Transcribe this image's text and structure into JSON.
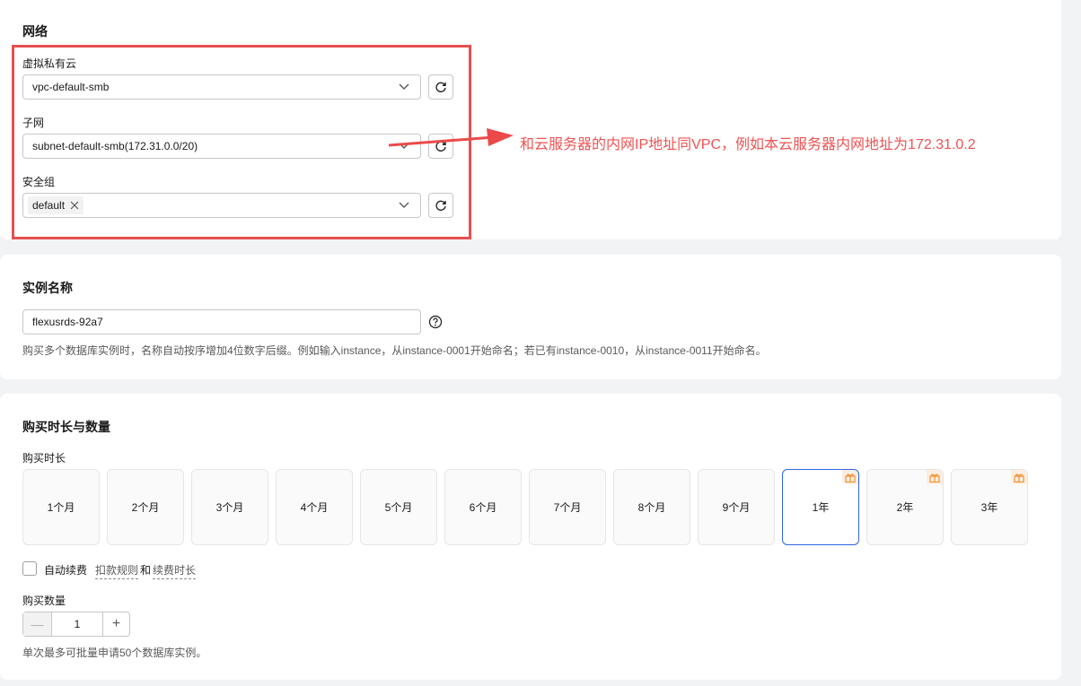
{
  "network": {
    "title": "网络",
    "vpc": {
      "label": "虚拟私有云",
      "value": "vpc-default-smb"
    },
    "subnet": {
      "label": "子网",
      "value": "subnet-default-smb(172.31.0.0/20)"
    },
    "security_group": {
      "label": "安全组",
      "tag": "default"
    }
  },
  "annotation": {
    "text": "和云服务器的内网IP地址同VPC，例如本云服务器内网地址为172.31.0.2",
    "color": "#f05252"
  },
  "instance_name": {
    "title": "实例名称",
    "value": "flexusrds-92a7",
    "hint": "购买多个数据库实例时，名称自动按序增加4位数字后缀。例如输入instance，从instance-0001开始命名；若已有instance-0010，从instance-0011开始命名。"
  },
  "purchase": {
    "title": "购买时长与数量",
    "duration_label": "购买时长",
    "durations": [
      {
        "label": "1个月",
        "gift": false,
        "selected": false
      },
      {
        "label": "2个月",
        "gift": false,
        "selected": false
      },
      {
        "label": "3个月",
        "gift": false,
        "selected": false
      },
      {
        "label": "4个月",
        "gift": false,
        "selected": false
      },
      {
        "label": "5个月",
        "gift": false,
        "selected": false
      },
      {
        "label": "6个月",
        "gift": false,
        "selected": false
      },
      {
        "label": "7个月",
        "gift": false,
        "selected": false
      },
      {
        "label": "8个月",
        "gift": false,
        "selected": false
      },
      {
        "label": "9个月",
        "gift": false,
        "selected": false
      },
      {
        "label": "1年",
        "gift": true,
        "selected": true
      },
      {
        "label": "2年",
        "gift": true,
        "selected": false
      },
      {
        "label": "3年",
        "gift": true,
        "selected": false
      }
    ],
    "auto_renew_label": "自动续费",
    "deduct_rule_link": "扣款规则",
    "and_text": "和",
    "renew_duration_link": "续费时长",
    "quantity_label": "购买数量",
    "quantity_value": "1",
    "quantity_hint": "单次最多可批量申请50个数据库实例。"
  },
  "colors": {
    "accent": "#2d64e6",
    "highlight_box": "#e84f4f",
    "gift": "#f08a24"
  }
}
